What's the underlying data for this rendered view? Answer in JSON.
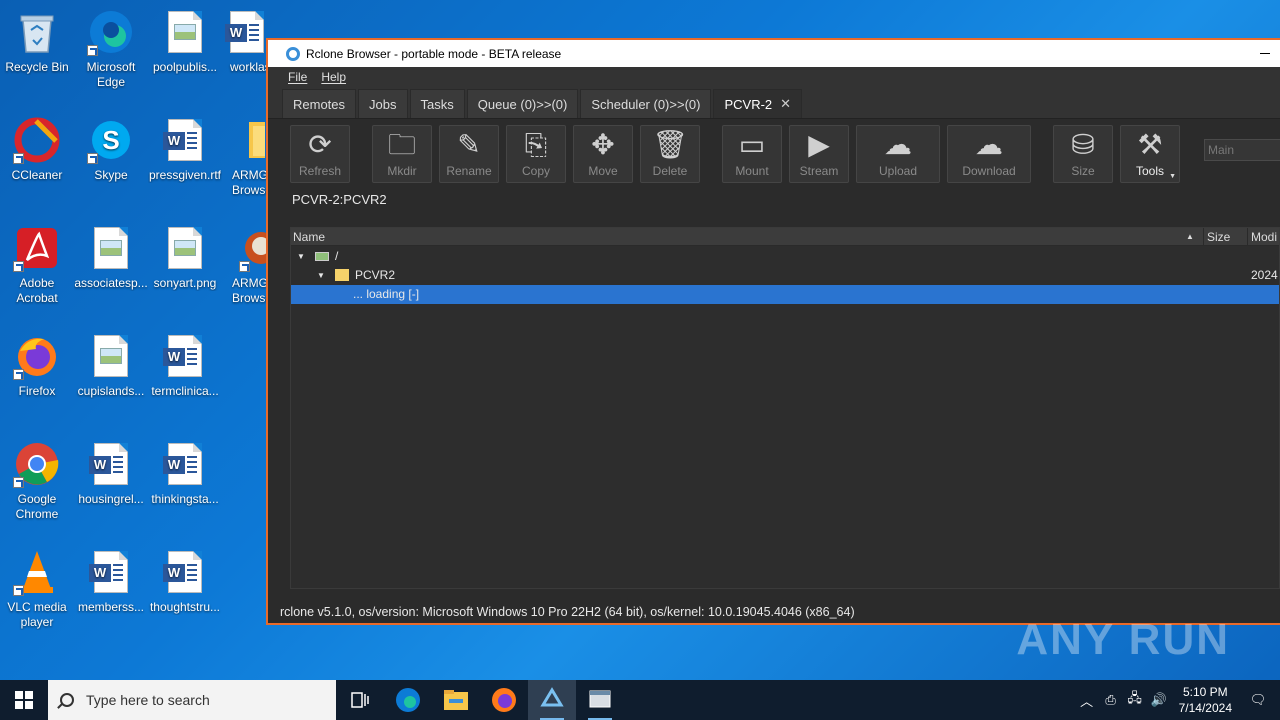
{
  "desktop": {
    "icons": [
      {
        "label": "Recycle Bin",
        "icon": "recycle-bin-icon"
      },
      {
        "label": "Microsoft Edge",
        "icon": "edge-icon"
      },
      {
        "label": "poolpublis...",
        "icon": "image-file-icon"
      },
      {
        "label": "worklaser...",
        "icon": "word-doc-icon"
      },
      {
        "label": "CCleaner",
        "icon": "ccleaner-icon"
      },
      {
        "label": "Skype",
        "icon": "skype-icon"
      },
      {
        "label": "pressgiven.rtf",
        "icon": "word-doc-icon"
      },
      {
        "label": "ARMGOD Browser",
        "icon": "folder-icon"
      },
      {
        "label": "Adobe Acrobat",
        "icon": "acrobat-icon"
      },
      {
        "label": "associatesp...",
        "icon": "image-file-icon"
      },
      {
        "label": "sonyart.png",
        "icon": "image-file-icon"
      },
      {
        "label": "ARMGOD Browser",
        "icon": "armgod-icon"
      },
      {
        "label": "Firefox",
        "icon": "firefox-icon"
      },
      {
        "label": "cupislands...",
        "icon": "image-file-icon"
      },
      {
        "label": "termclinica...",
        "icon": "word-doc-icon"
      },
      {
        "label": "Google Chrome",
        "icon": "chrome-icon"
      },
      {
        "label": "housingrel...",
        "icon": "word-doc-icon"
      },
      {
        "label": "thinkingsta...",
        "icon": "word-doc-icon"
      },
      {
        "label": "VLC media player",
        "icon": "vlc-icon"
      },
      {
        "label": "memberss...",
        "icon": "word-doc-icon"
      },
      {
        "label": "thoughtstru...",
        "icon": "word-doc-icon"
      }
    ]
  },
  "window": {
    "title": "Rclone Browser - portable mode - BETA release",
    "menu": [
      "File",
      "Help"
    ],
    "tabs": [
      "Remotes",
      "Jobs",
      "Tasks",
      "Queue (0)>>(0)",
      "Scheduler (0)>>(0)",
      "PCVR-2"
    ],
    "toolbar": {
      "buttons": [
        {
          "label": "Refresh",
          "icon": "refresh-icon"
        },
        {
          "label": "Mkdir",
          "icon": "new-folder-icon"
        },
        {
          "label": "Rename",
          "icon": "rename-icon"
        },
        {
          "label": "Copy",
          "icon": "copy-icon"
        },
        {
          "label": "Move",
          "icon": "move-icon"
        },
        {
          "label": "Delete",
          "icon": "trash-icon"
        },
        {
          "label": "Mount",
          "icon": "mount-icon"
        },
        {
          "label": "Stream",
          "icon": "stream-icon"
        },
        {
          "label": "Upload",
          "icon": "upload-icon"
        },
        {
          "label": "Download",
          "icon": "download-icon"
        },
        {
          "label": "Size",
          "icon": "size-icon"
        },
        {
          "label": "Tools",
          "icon": "tools-icon"
        }
      ],
      "select_value": "Main"
    },
    "path": "PCVR-2:PCVR2",
    "tree": {
      "columns": [
        "Name",
        "Size",
        "Modi"
      ],
      "rows": [
        {
          "name": "/",
          "modified": ""
        },
        {
          "name": "PCVR2",
          "modified": "2024"
        },
        {
          "name": "... loading [-]",
          "modified": ""
        }
      ]
    },
    "status": "rclone v5.1.0, os/version: Microsoft Windows 10 Pro 22H2 (64 bit), os/kernel: 10.0.19045.4046 (x86_64)"
  },
  "watermark": "ANY RUN",
  "taskbar": {
    "search_placeholder": "Type here to search",
    "time": "5:10 PM",
    "date": "7/14/2024"
  }
}
